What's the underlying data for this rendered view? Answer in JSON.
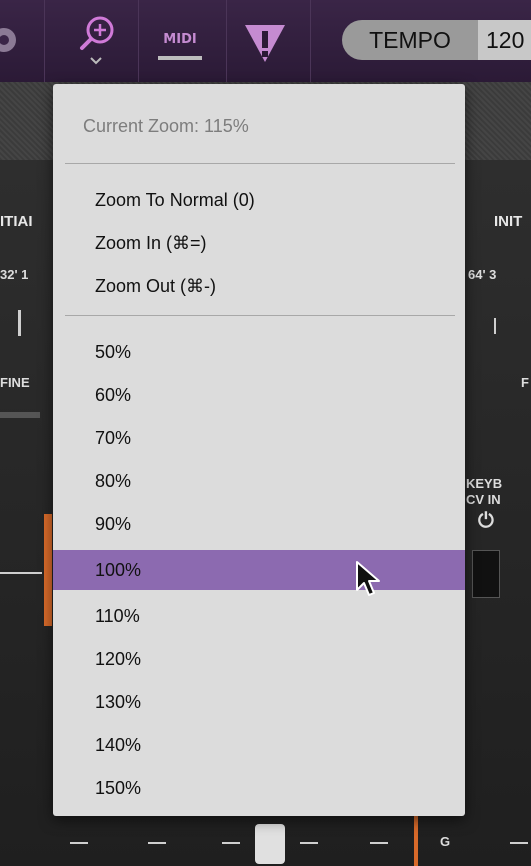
{
  "toolbar": {
    "icons": [
      "gear-icon",
      "zoom-icon",
      "midi-icon",
      "warning-icon"
    ],
    "midi_label": "MIDI",
    "tempo_label": "TEMPO",
    "tempo_value": "120"
  },
  "panel": {
    "label_left_top": "ITIAI",
    "label_right_top": "INIT",
    "label_left_ft": "32' 1",
    "label_right_ft": "64' 3",
    "label_left_fine": "FINE",
    "label_right_fine": "F",
    "keyb_label": "KEYB",
    "cvin_label": "CV IN",
    "g_label": "G"
  },
  "menu": {
    "header": "Current Zoom: 115%",
    "commands": [
      {
        "label": "Zoom To Normal (0)"
      },
      {
        "label": "Zoom In (⌘=)"
      },
      {
        "label": "Zoom Out (⌘-)"
      }
    ],
    "levels": [
      {
        "label": "50%"
      },
      {
        "label": "60%"
      },
      {
        "label": "70%"
      },
      {
        "label": "80%"
      },
      {
        "label": "90%"
      },
      {
        "label": "100%"
      },
      {
        "label": "110%"
      },
      {
        "label": "120%"
      },
      {
        "label": "130%"
      },
      {
        "label": "140%"
      },
      {
        "label": "150%"
      }
    ],
    "selected_level": "100%",
    "highlight_color": "#8c6ab0"
  }
}
